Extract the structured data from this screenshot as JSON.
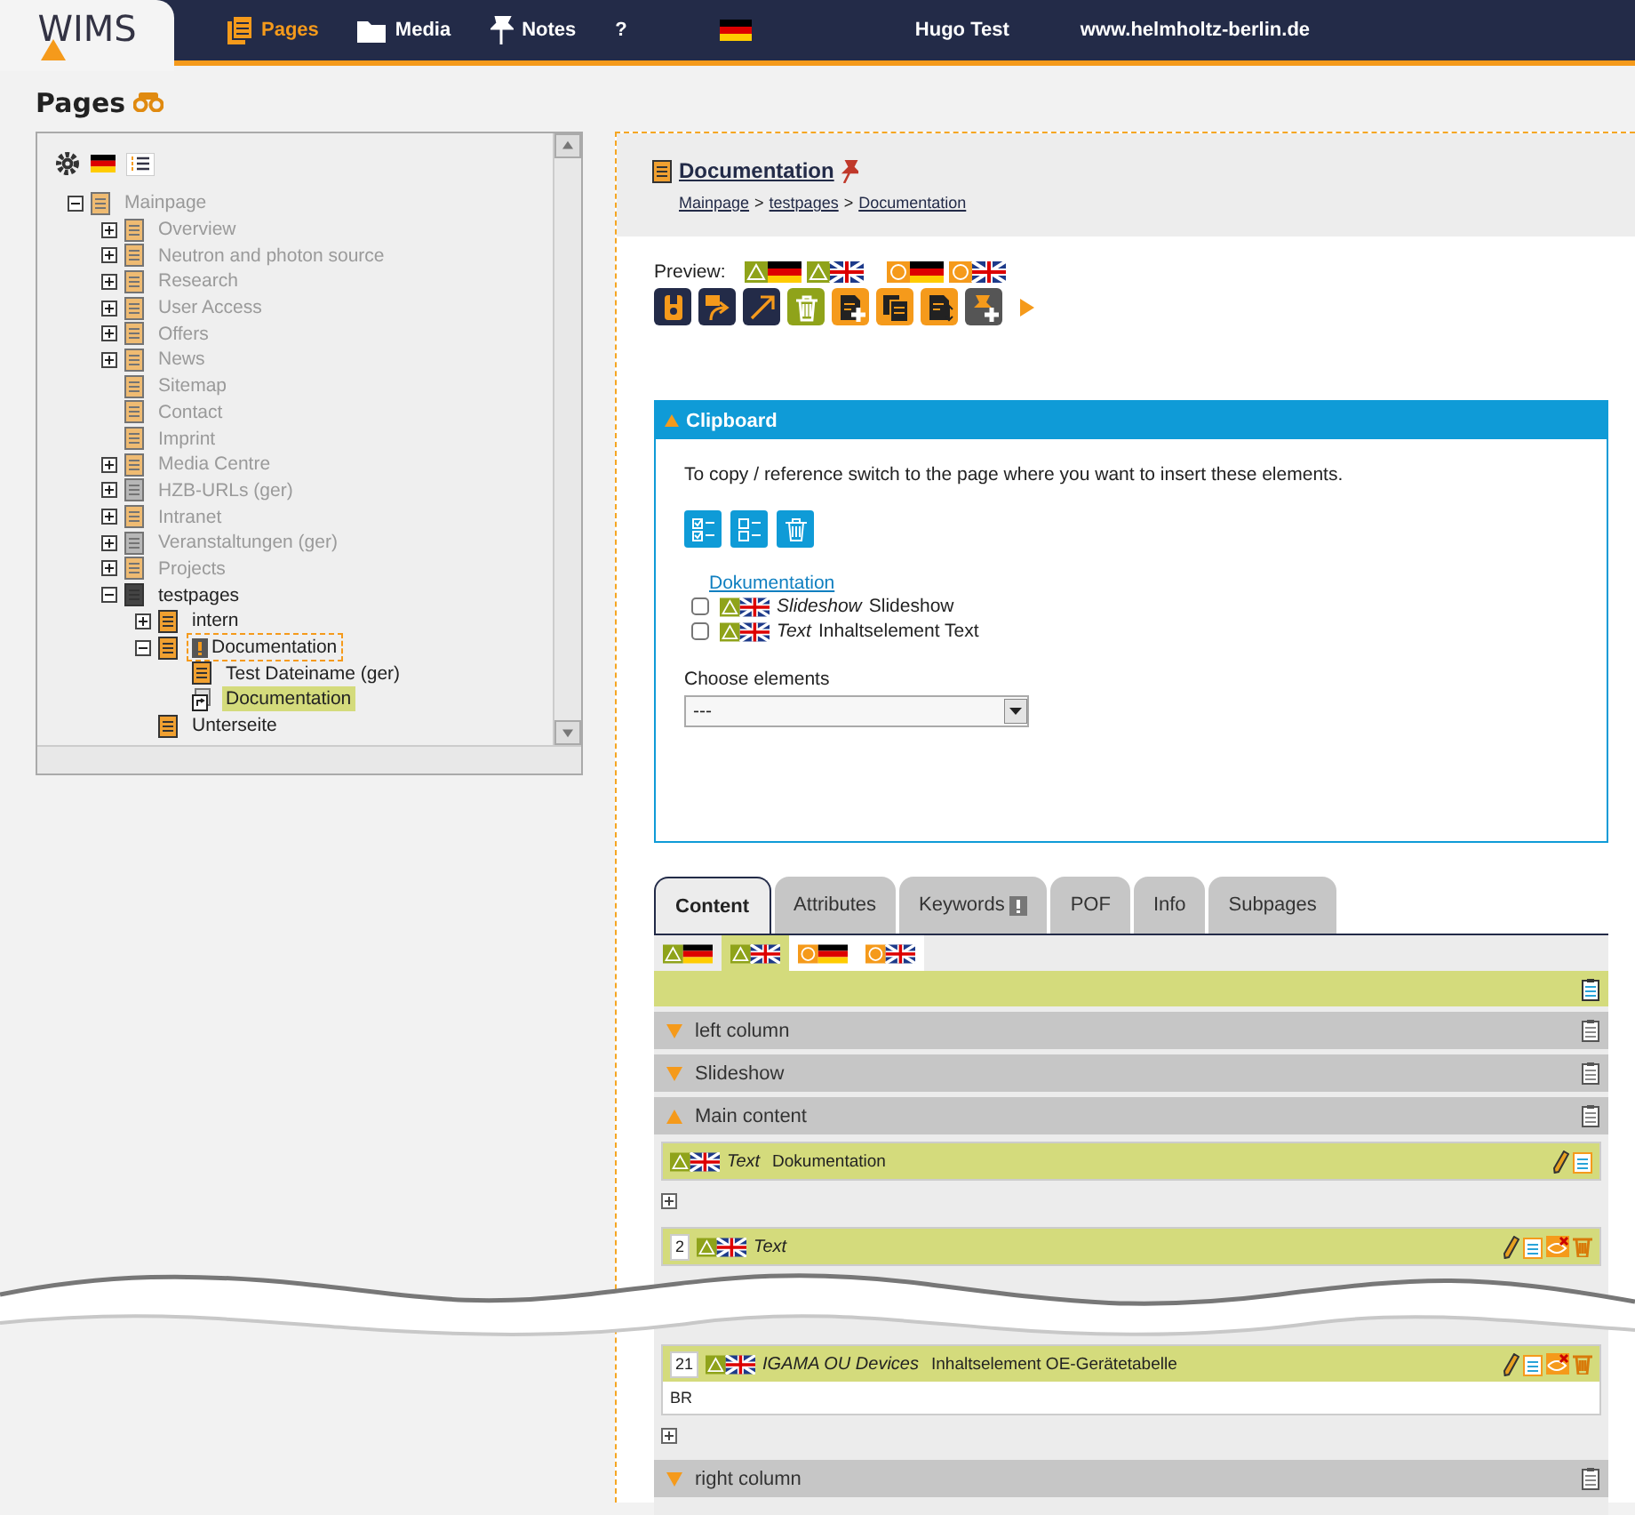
{
  "header": {
    "logo": "WIMS",
    "nav": [
      {
        "label": "Pages",
        "kind": "pages",
        "selected": true
      },
      {
        "label": "Media",
        "kind": "media",
        "selected": false
      },
      {
        "label": "Notes",
        "kind": "notes",
        "selected": false
      },
      {
        "label": "?",
        "kind": "help",
        "selected": false
      }
    ],
    "user": "Hugo Test",
    "site": "www.helmholtz-berlin.de"
  },
  "page_title": "Pages",
  "tree": [
    {
      "label": "Mainpage",
      "kind": "page",
      "expanded": true,
      "muted": true,
      "selected": false,
      "flagged": false,
      "children": [
        {
          "label": "Overview",
          "kind": "page",
          "expanded": false,
          "muted": true,
          "selected": false,
          "flagged": false
        },
        {
          "label": "Neutron and photon source",
          "kind": "page",
          "expanded": false,
          "muted": true,
          "selected": false,
          "flagged": false
        },
        {
          "label": "Research",
          "kind": "page",
          "expanded": false,
          "muted": true,
          "selected": false,
          "flagged": false
        },
        {
          "label": "User Access",
          "kind": "page",
          "expanded": false,
          "muted": true,
          "selected": false,
          "flagged": false
        },
        {
          "label": "Offers",
          "kind": "page",
          "expanded": false,
          "muted": true,
          "selected": false,
          "flagged": false
        },
        {
          "label": "News",
          "kind": "page",
          "expanded": false,
          "muted": true,
          "selected": false,
          "flagged": false
        },
        {
          "label": "Sitemap",
          "kind": "page",
          "muted": true,
          "selected": false,
          "flagged": false
        },
        {
          "label": "Contact",
          "kind": "page",
          "muted": true,
          "selected": false,
          "flagged": false
        },
        {
          "label": "Imprint",
          "kind": "page",
          "muted": true,
          "selected": false,
          "flagged": false
        },
        {
          "label": "Media Centre",
          "kind": "page",
          "expanded": false,
          "muted": true,
          "selected": false,
          "flagged": false
        },
        {
          "label": "HZB-URLs (ger)",
          "kind": "grey",
          "expanded": false,
          "muted": true,
          "selected": false,
          "flagged": false
        },
        {
          "label": "Intranet",
          "kind": "page",
          "expanded": false,
          "muted": true,
          "selected": false,
          "flagged": false
        },
        {
          "label": "Veranstaltungen (ger)",
          "kind": "grey",
          "expanded": false,
          "muted": true,
          "selected": false,
          "flagged": false
        },
        {
          "label": "Projects",
          "kind": "page",
          "expanded": false,
          "muted": true,
          "selected": false,
          "flagged": false
        },
        {
          "label": "testpages",
          "kind": "dark",
          "expanded": true,
          "muted": false,
          "selected": false,
          "flagged": false,
          "children": [
            {
              "label": "intern",
              "kind": "page",
              "expanded": false,
              "muted": false,
              "selected": false,
              "flagged": false
            },
            {
              "label": "Documentation",
              "kind": "page",
              "expanded": true,
              "muted": false,
              "selected": false,
              "flagged": true,
              "children": [
                {
                  "label": "Test Dateiname (ger)",
                  "kind": "page",
                  "muted": false,
                  "selected": false,
                  "flagged": false
                },
                {
                  "label": "Documentation",
                  "kind": "link",
                  "muted": false,
                  "selected": true,
                  "flagged": false
                }
              ]
            },
            {
              "label": "Unterseite",
              "kind": "page",
              "muted": false,
              "selected": false,
              "flagged": false
            }
          ]
        }
      ]
    }
  ],
  "detail": {
    "title": "Documentation",
    "breadcrumbs": [
      {
        "label": "Mainpage"
      },
      {
        "label": "testpages"
      },
      {
        "label": "Documentation"
      }
    ],
    "separator": ">",
    "preview_label": "Preview:",
    "previews": [
      {
        "kind": "draft-de"
      },
      {
        "kind": "draft-en"
      },
      {
        "kind": "live-de"
      },
      {
        "kind": "live-en"
      }
    ],
    "toolbar": [
      {
        "kind": "save",
        "color": "#232b48"
      },
      {
        "kind": "forward",
        "color": "#232b48"
      },
      {
        "kind": "link",
        "color": "#232b48"
      },
      {
        "kind": "delete",
        "color": "#8fa31a"
      },
      {
        "kind": "new",
        "color": "#f59a1b"
      },
      {
        "kind": "copy",
        "color": "#f59a1b"
      },
      {
        "kind": "move",
        "color": "#f59a1b"
      },
      {
        "kind": "pin",
        "color": "#555555"
      }
    ]
  },
  "clipboard": {
    "title": "Clipboard",
    "expanded": true,
    "text": "To copy / reference switch to the page where you want to insert these elements.",
    "link": "Dokumentation",
    "items": [
      {
        "type": "Slideshow",
        "title": "Slideshow",
        "checked": false
      },
      {
        "type": "Text",
        "title": "Inhaltselement Text",
        "checked": false
      }
    ],
    "choose_label": "Choose elements",
    "choose_value": "---"
  },
  "tabs": [
    {
      "label": "Content",
      "selected": true,
      "warning": false
    },
    {
      "label": "Attributes",
      "selected": false,
      "warning": false
    },
    {
      "label": "Keywords",
      "selected": false,
      "warning": true
    },
    {
      "label": "POF",
      "selected": false,
      "warning": false
    },
    {
      "label": "Info",
      "selected": false,
      "warning": false
    },
    {
      "label": "Subpages",
      "selected": false,
      "warning": false
    }
  ],
  "languages": [
    {
      "kind": "draft-de",
      "selected": false
    },
    {
      "kind": "draft-en",
      "selected": true
    },
    {
      "kind": "live-de",
      "selected": false
    },
    {
      "kind": "live-en",
      "selected": false
    }
  ],
  "sections": [
    {
      "label": "left column",
      "expanded": false
    },
    {
      "label": "Slideshow",
      "expanded": false
    },
    {
      "label": "Main content",
      "expanded": true,
      "elements": [
        {
          "kind": "short",
          "type": "Text",
          "title": "Dokumentation"
        },
        {
          "kind": "full",
          "number": "2",
          "type": "Text"
        },
        {
          "kind": "full",
          "number": "21",
          "type": "IGAMA OU Devices",
          "title": "Inhaltselement OE-Gerätetabelle",
          "body": "BR"
        }
      ]
    },
    {
      "label": "right column",
      "expanded": false
    }
  ]
}
